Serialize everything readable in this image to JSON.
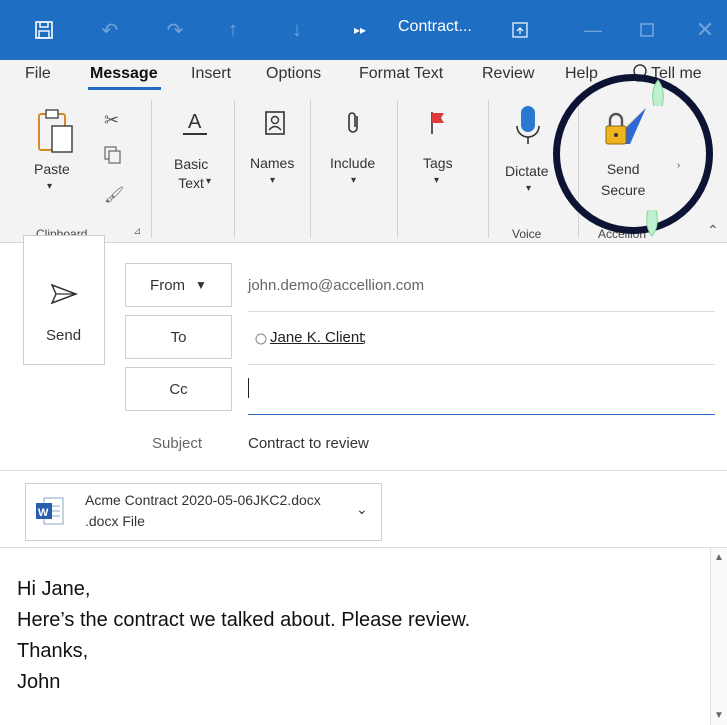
{
  "titlebar": {
    "title": "Contract..."
  },
  "menu": {
    "items": [
      "File",
      "Message",
      "Insert",
      "Options",
      "Format Text",
      "Review",
      "Help",
      "Tell me"
    ]
  },
  "ribbon": {
    "paste": "Paste",
    "basic_text": "Basic\nText",
    "names": "Names",
    "include": "Include",
    "tags": "Tags",
    "dictate": "Dictate",
    "send_secure": "Send\nSecure",
    "groups": {
      "clipboard": "Clipboard",
      "voice": "Voice",
      "accellion": "Accellion"
    }
  },
  "compose": {
    "send": "Send",
    "from_label": "From",
    "from_value": "john.demo@accellion.com",
    "to_label": "To",
    "to_value": "Jane K. Client",
    "to_sep": ";",
    "cc_label": "Cc",
    "subject_label": "Subject",
    "subject_value": "Contract to review"
  },
  "attachment": {
    "name": "Acme Contract 2020-05-06JKC2.docx",
    "type": ".docx File"
  },
  "body": {
    "lines": [
      "Hi Jane,",
      "Here’s the contract we talked about. Please review.",
      "Thanks,",
      "John"
    ]
  },
  "colors": {
    "titlebar": "#1e6fc3",
    "ribbon": "#f3f3f3",
    "highlight": "#0d1433"
  }
}
